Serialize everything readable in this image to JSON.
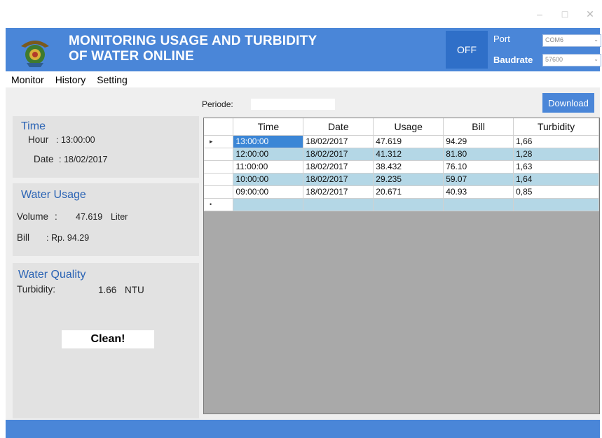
{
  "window": {
    "controls": [
      "–",
      "□",
      "✕"
    ]
  },
  "header": {
    "title_line1": "MONITORING USAGE AND TURBIDITY",
    "title_line2": "OF WATER ONLINE",
    "off_button": "OFF",
    "port_label": "Port",
    "baudrate_label": "Baudrate",
    "port_value": "COM6",
    "baudrate_value": "57600",
    "accent_color": "#4a86d8"
  },
  "tabs": [
    "Monitor",
    "History",
    "Setting"
  ],
  "time_panel": {
    "title": "Time",
    "hour_label": "Hour",
    "hour_value": ": 13:00:00",
    "date_label": "Date",
    "date_value": ": 18/02/2017"
  },
  "usage_panel": {
    "title": "Water Usage",
    "volume_label": "Volume",
    "volume_sep": ":",
    "volume_value": "47.619",
    "volume_unit": "Liter",
    "bill_label": "Bill",
    "bill_value": ": Rp. 94.29"
  },
  "quality_panel": {
    "title": "Water Quality",
    "turbidity_label": "Turbidity:",
    "turbidity_value": "1.66",
    "turbidity_unit": "NTU",
    "status": "Clean!"
  },
  "periode": {
    "label": "Periode:",
    "value": ""
  },
  "download_button": "Download",
  "table": {
    "headers": [
      "Time",
      "Date",
      "Usage",
      "Bill",
      "Turbidity"
    ],
    "rows": [
      {
        "marker": "▸",
        "time": "13:00:00",
        "date": "18/02/2017",
        "usage": "47.619",
        "bill": "94.29",
        "turbidity": "1,66"
      },
      {
        "marker": "",
        "time": "12:00:00",
        "date": "18/02/2017",
        "usage": "41.312",
        "bill": "81.80",
        "turbidity": "1,28"
      },
      {
        "marker": "",
        "time": "11:00:00",
        "date": "18/02/2017",
        "usage": "38.432",
        "bill": "76.10",
        "turbidity": "1,63"
      },
      {
        "marker": "",
        "time": "10:00:00",
        "date": "18/02/2017",
        "usage": "29.235",
        "bill": "59.07",
        "turbidity": "1,64"
      },
      {
        "marker": "",
        "time": "09:00:00",
        "date": "18/02/2017",
        "usage": "20.671",
        "bill": "40.93",
        "turbidity": "0,85"
      }
    ],
    "new_row_marker": "•"
  }
}
